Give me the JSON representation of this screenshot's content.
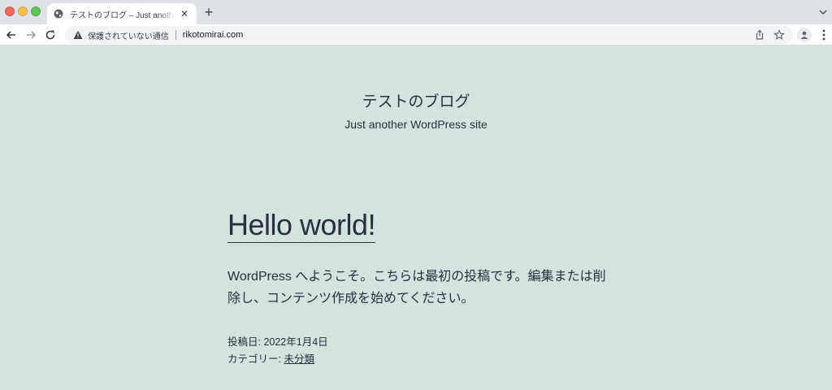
{
  "browser": {
    "tab": {
      "title": "テストのブログ – Just another WordPress site",
      "close_glyph": "✕",
      "favicon": "globe-icon"
    },
    "new_tab_glyph": "+",
    "address_bar": {
      "security_text": "保護されていない通信",
      "url": "rikotomirai.com"
    },
    "icons": {
      "back": "arrow-left-icon",
      "forward": "arrow-right-icon",
      "reload": "reload-icon",
      "warning": "warning-icon",
      "share": "share-icon",
      "bookmark": "star-icon",
      "profile": "avatar-icon",
      "menu": "kebab-menu-icon",
      "tab_search": "chevron-down-icon"
    }
  },
  "site": {
    "title": "テストのブログ",
    "description": "Just another WordPress site",
    "background_color": "#d1e4dd"
  },
  "post": {
    "title": "Hello world!",
    "body": "WordPress へようこそ。こちらは最初の投稿です。編集または削除し、コンテンツ作成を始めてください。",
    "date_label": "投稿日: ",
    "date": "2022年1月4日",
    "category_label": "カテゴリー: ",
    "category": "未分類"
  }
}
